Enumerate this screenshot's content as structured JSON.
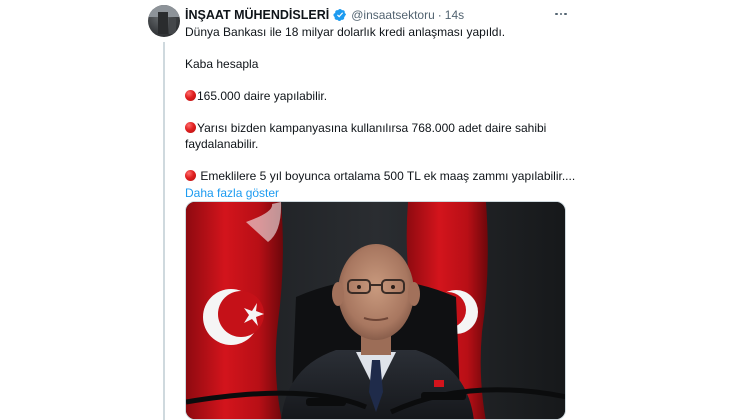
{
  "tweet": {
    "author_name": "İNŞAAT MÜHENDİSLERİ",
    "handle": "@insaatsektoru",
    "separator": "·",
    "time": "14s",
    "text_line1": "Dünya Bankası ile 18 milyar dolarlık kredi anlaşması yapıldı.",
    "text_line2": "Kaba hesapla",
    "bullet1": "165.000 daire yapılabilir.",
    "bullet2": "Yarısı bizden kampanyasına kullanılırsa 768.000 adet daire sahibi faydalanabilir.",
    "bullet3": " Emeklilere 5 yıl boyunca ortalama 500 TL ek maaş zammı yapılabilir....",
    "show_more": "Daha fazla göster"
  },
  "icons": {
    "verified": "verified-badge-icon",
    "more": "more-options-icon",
    "bullet": "red-circle-emoji-icon"
  },
  "colors": {
    "link": "#1d9bf0",
    "secondary_text": "#536471",
    "thread_line": "#cfd9de",
    "bullet_red": "#e02020"
  }
}
